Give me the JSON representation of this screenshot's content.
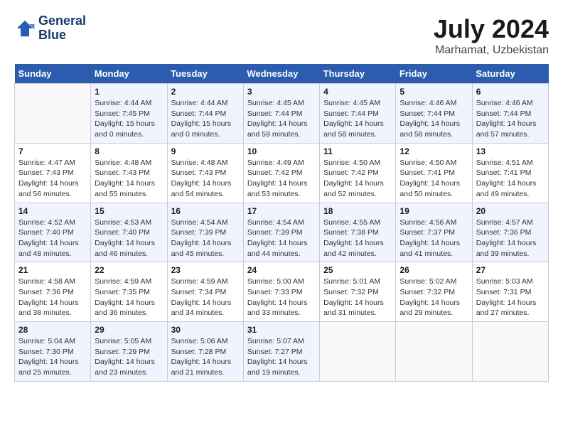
{
  "header": {
    "logo_line1": "General",
    "logo_line2": "Blue",
    "month_year": "July 2024",
    "location": "Marhamat, Uzbekistan"
  },
  "days_of_week": [
    "Sunday",
    "Monday",
    "Tuesday",
    "Wednesday",
    "Thursday",
    "Friday",
    "Saturday"
  ],
  "weeks": [
    [
      {
        "day": "",
        "info": ""
      },
      {
        "day": "1",
        "info": "Sunrise: 4:44 AM\nSunset: 7:45 PM\nDaylight: 15 hours\nand 0 minutes."
      },
      {
        "day": "2",
        "info": "Sunrise: 4:44 AM\nSunset: 7:44 PM\nDaylight: 15 hours\nand 0 minutes."
      },
      {
        "day": "3",
        "info": "Sunrise: 4:45 AM\nSunset: 7:44 PM\nDaylight: 14 hours\nand 59 minutes."
      },
      {
        "day": "4",
        "info": "Sunrise: 4:45 AM\nSunset: 7:44 PM\nDaylight: 14 hours\nand 58 minutes."
      },
      {
        "day": "5",
        "info": "Sunrise: 4:46 AM\nSunset: 7:44 PM\nDaylight: 14 hours\nand 58 minutes."
      },
      {
        "day": "6",
        "info": "Sunrise: 4:46 AM\nSunset: 7:44 PM\nDaylight: 14 hours\nand 57 minutes."
      }
    ],
    [
      {
        "day": "7",
        "info": "Sunrise: 4:47 AM\nSunset: 7:43 PM\nDaylight: 14 hours\nand 56 minutes."
      },
      {
        "day": "8",
        "info": "Sunrise: 4:48 AM\nSunset: 7:43 PM\nDaylight: 14 hours\nand 55 minutes."
      },
      {
        "day": "9",
        "info": "Sunrise: 4:48 AM\nSunset: 7:43 PM\nDaylight: 14 hours\nand 54 minutes."
      },
      {
        "day": "10",
        "info": "Sunrise: 4:49 AM\nSunset: 7:42 PM\nDaylight: 14 hours\nand 53 minutes."
      },
      {
        "day": "11",
        "info": "Sunrise: 4:50 AM\nSunset: 7:42 PM\nDaylight: 14 hours\nand 52 minutes."
      },
      {
        "day": "12",
        "info": "Sunrise: 4:50 AM\nSunset: 7:41 PM\nDaylight: 14 hours\nand 50 minutes."
      },
      {
        "day": "13",
        "info": "Sunrise: 4:51 AM\nSunset: 7:41 PM\nDaylight: 14 hours\nand 49 minutes."
      }
    ],
    [
      {
        "day": "14",
        "info": "Sunrise: 4:52 AM\nSunset: 7:40 PM\nDaylight: 14 hours\nand 48 minutes."
      },
      {
        "day": "15",
        "info": "Sunrise: 4:53 AM\nSunset: 7:40 PM\nDaylight: 14 hours\nand 46 minutes."
      },
      {
        "day": "16",
        "info": "Sunrise: 4:54 AM\nSunset: 7:39 PM\nDaylight: 14 hours\nand 45 minutes."
      },
      {
        "day": "17",
        "info": "Sunrise: 4:54 AM\nSunset: 7:39 PM\nDaylight: 14 hours\nand 44 minutes."
      },
      {
        "day": "18",
        "info": "Sunrise: 4:55 AM\nSunset: 7:38 PM\nDaylight: 14 hours\nand 42 minutes."
      },
      {
        "day": "19",
        "info": "Sunrise: 4:56 AM\nSunset: 7:37 PM\nDaylight: 14 hours\nand 41 minutes."
      },
      {
        "day": "20",
        "info": "Sunrise: 4:57 AM\nSunset: 7:36 PM\nDaylight: 14 hours\nand 39 minutes."
      }
    ],
    [
      {
        "day": "21",
        "info": "Sunrise: 4:58 AM\nSunset: 7:36 PM\nDaylight: 14 hours\nand 38 minutes."
      },
      {
        "day": "22",
        "info": "Sunrise: 4:59 AM\nSunset: 7:35 PM\nDaylight: 14 hours\nand 36 minutes."
      },
      {
        "day": "23",
        "info": "Sunrise: 4:59 AM\nSunset: 7:34 PM\nDaylight: 14 hours\nand 34 minutes."
      },
      {
        "day": "24",
        "info": "Sunrise: 5:00 AM\nSunset: 7:33 PM\nDaylight: 14 hours\nand 33 minutes."
      },
      {
        "day": "25",
        "info": "Sunrise: 5:01 AM\nSunset: 7:32 PM\nDaylight: 14 hours\nand 31 minutes."
      },
      {
        "day": "26",
        "info": "Sunrise: 5:02 AM\nSunset: 7:32 PM\nDaylight: 14 hours\nand 29 minutes."
      },
      {
        "day": "27",
        "info": "Sunrise: 5:03 AM\nSunset: 7:31 PM\nDaylight: 14 hours\nand 27 minutes."
      }
    ],
    [
      {
        "day": "28",
        "info": "Sunrise: 5:04 AM\nSunset: 7:30 PM\nDaylight: 14 hours\nand 25 minutes."
      },
      {
        "day": "29",
        "info": "Sunrise: 5:05 AM\nSunset: 7:29 PM\nDaylight: 14 hours\nand 23 minutes."
      },
      {
        "day": "30",
        "info": "Sunrise: 5:06 AM\nSunset: 7:28 PM\nDaylight: 14 hours\nand 21 minutes."
      },
      {
        "day": "31",
        "info": "Sunrise: 5:07 AM\nSunset: 7:27 PM\nDaylight: 14 hours\nand 19 minutes."
      },
      {
        "day": "",
        "info": ""
      },
      {
        "day": "",
        "info": ""
      },
      {
        "day": "",
        "info": ""
      }
    ]
  ]
}
